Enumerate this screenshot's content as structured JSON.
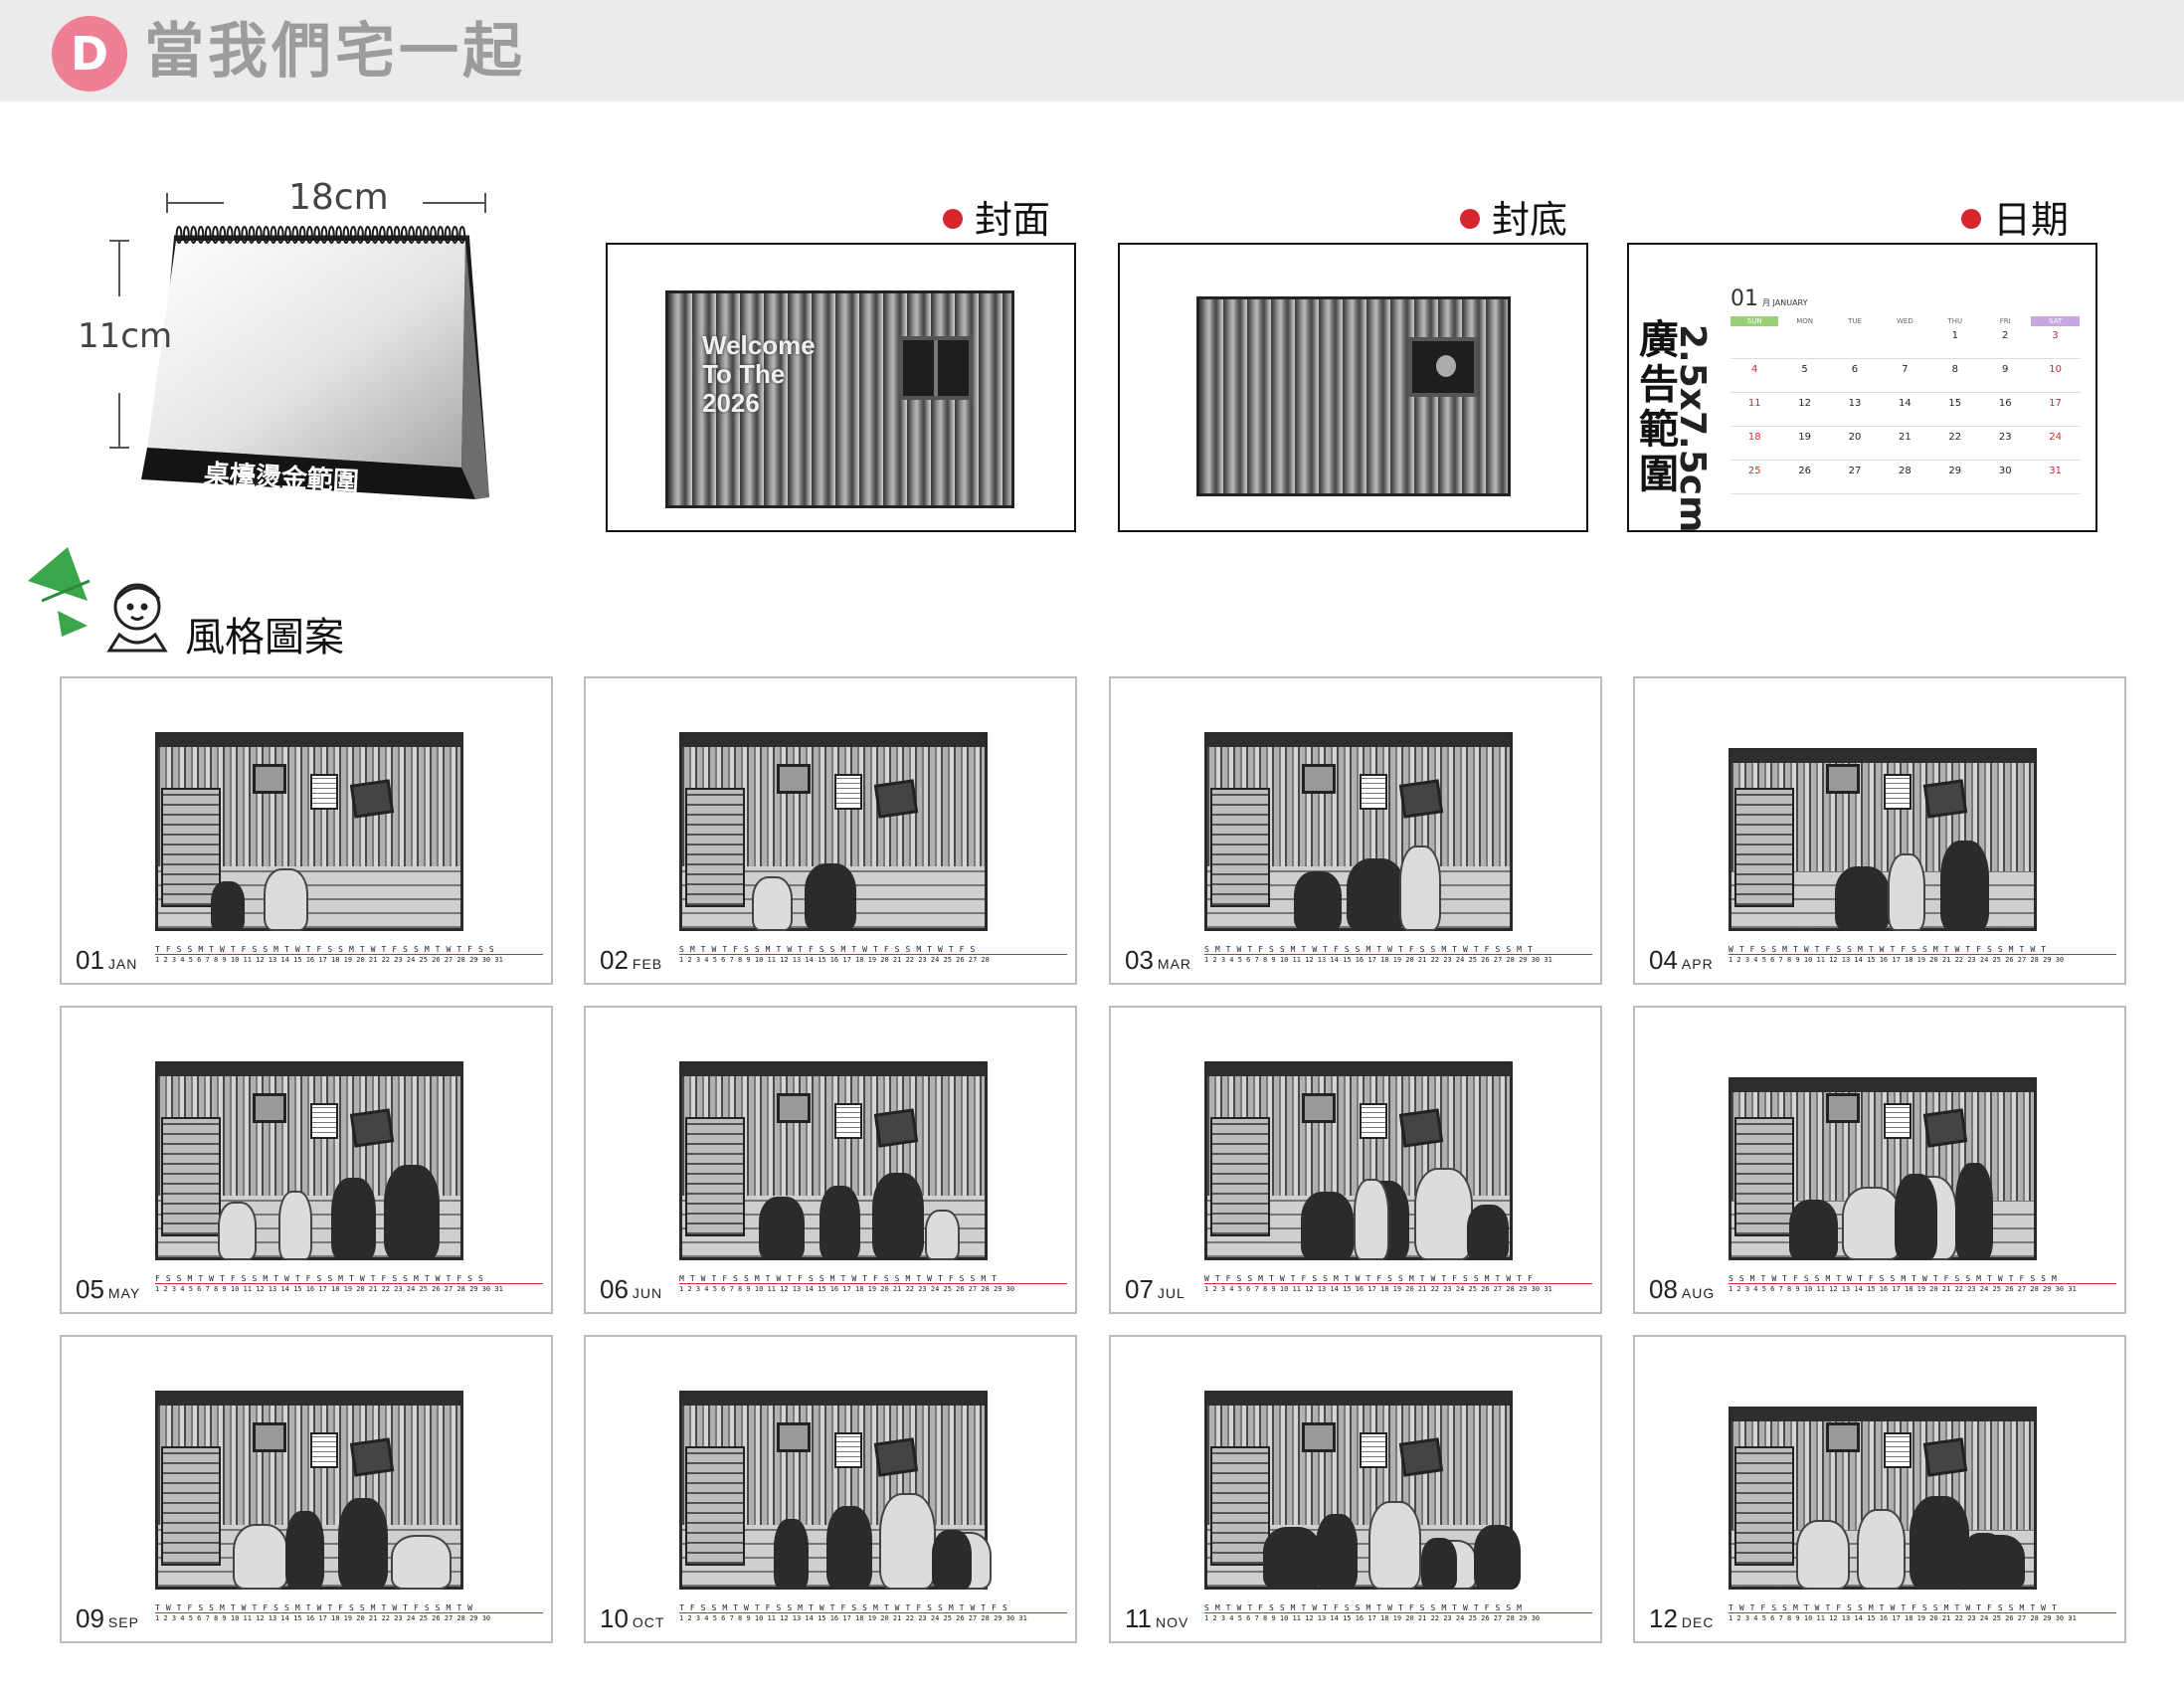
{
  "header": {
    "badge": "D",
    "title": "當我們宅一起"
  },
  "product": {
    "width_label": "18cm",
    "height_label": "11cm",
    "base_label": "桌檯燙金範圍"
  },
  "sections": {
    "cover": "封面",
    "back": "封底",
    "date": "日期"
  },
  "cover": {
    "line1": "Welcome",
    "line2": "To The",
    "line3": "2026"
  },
  "date_page": {
    "month_num": "01",
    "month_name": "月 JANUARY",
    "weekdays": [
      "SUN",
      "MON",
      "TUE",
      "WED",
      "THU",
      "FRI",
      "SAT"
    ],
    "weeks": [
      [
        "",
        "",
        "",
        "",
        "1",
        "2",
        "3"
      ],
      [
        "4",
        "5",
        "6",
        "7",
        "8",
        "9",
        "10"
      ],
      [
        "11",
        "12",
        "13",
        "14",
        "15",
        "16",
        "17"
      ],
      [
        "18",
        "19",
        "20",
        "21",
        "22",
        "23",
        "24"
      ],
      [
        "25",
        "26",
        "27",
        "28",
        "29",
        "30",
        "31"
      ]
    ],
    "ad_area_label": "廣告範圍",
    "ad_area_size": "2.5x7.5cm",
    "accent_sun": "#9ad07a",
    "accent_sat": "#c9a8e0",
    "accent_red": "#d7262e"
  },
  "style_section": {
    "title": "風格圖案"
  },
  "months": [
    {
      "num": "01",
      "abbr": "JAN",
      "wd": "T F S S M T W T F S S M T W T F S S M T W T F S S M T W T F S S",
      "dd": "1 2 3 4 5 6 7 8 9 10 11 12 13 14 15 16 17 18 19 20 21 22 23 24 25 26 27 28 29 30 31"
    },
    {
      "num": "02",
      "abbr": "FEB",
      "wd": "S M T W T F S S M T W T F S S M T W T F S S M T W T F S",
      "dd": "1 2 3 4 5 6 7 8 9 10 11 12 13 14 15 16 17 18 19 20 21 22 23 24 25 26 27 28"
    },
    {
      "num": "03",
      "abbr": "MAR",
      "wd": "S M T W T F S S M T W T F S S M T W T F S S M T W T F S S M T",
      "dd": "1 2 3 4 5 6 7 8 9 10 11 12 13 14 15 16 17 18 19 20 21 22 23 24 25 26 27 28 29 30 31"
    },
    {
      "num": "04",
      "abbr": "APR",
      "wd": "W T F S S M T W T F S S M T W T F S S M T W T F S S M T W T",
      "dd": "1 2 3 4 5 6 7 8 9 10 11 12 13 14 15 16 17 18 19 20 21 22 23 24 25 26 27 28 29 30"
    },
    {
      "num": "05",
      "abbr": "MAY",
      "wd": "F S S M T W T F S S M T W T F S S M T W T F S S M T W T F S S",
      "dd": "1 2 3 4 5 6 7 8 9 10 11 12 13 14 15 16 17 18 19 20 21 22 23 24 25 26 27 28 29 30 31"
    },
    {
      "num": "06",
      "abbr": "JUN",
      "wd": "M T W T F S S M T W T F S S M T W T F S S M T W T F S S M T",
      "dd": "1 2 3 4 5 6 7 8 9 10 11 12 13 14 15 16 17 18 19 20 21 22 23 24 25 26 27 28 29 30"
    },
    {
      "num": "07",
      "abbr": "JUL",
      "wd": "W T F S S M T W T F S S M T W T F S S M T W T F S S M T W T F",
      "dd": "1 2 3 4 5 6 7 8 9 10 11 12 13 14 15 16 17 18 19 20 21 22 23 24 25 26 27 28 29 30 31"
    },
    {
      "num": "08",
      "abbr": "AUG",
      "wd": "S S M T W T F S S M T W T F S S M T W T F S S M T W T F S S M",
      "dd": "1 2 3 4 5 6 7 8 9 10 11 12 13 14 15 16 17 18 19 20 21 22 23 24 25 26 27 28 29 30 31"
    },
    {
      "num": "09",
      "abbr": "SEP",
      "wd": "T W T F S S M T W T F S S M T W T F S S M T W T F S S M T W",
      "dd": "1 2 3 4 5 6 7 8 9 10 11 12 13 14 15 16 17 18 19 20 21 22 23 24 25 26 27 28 29 30"
    },
    {
      "num": "10",
      "abbr": "OCT",
      "wd": "T F S S M T W T F S S M T W T F S S M T W T F S S M T W T F S",
      "dd": "1 2 3 4 5 6 7 8 9 10 11 12 13 14 15 16 17 18 19 20 21 22 23 24 25 26 27 28 29 30 31"
    },
    {
      "num": "11",
      "abbr": "NOV",
      "wd": "S M T W T F S S M T W T F S S M T W T F S S M T W T F S S M",
      "dd": "1 2 3 4 5 6 7 8 9 10 11 12 13 14 15 16 17 18 19 20 21 22 23 24 25 26 27 28 29 30"
    },
    {
      "num": "12",
      "abbr": "DEC",
      "wd": "T W T F S S M T W T F S S M T W T F S S M T W T F S S M T W T",
      "dd": "1 2 3 4 5 6 7 8 9 10 11 12 13 14 15 16 17 18 19 20 21 22 23 24 25 26 27 28 29 30 31"
    }
  ]
}
